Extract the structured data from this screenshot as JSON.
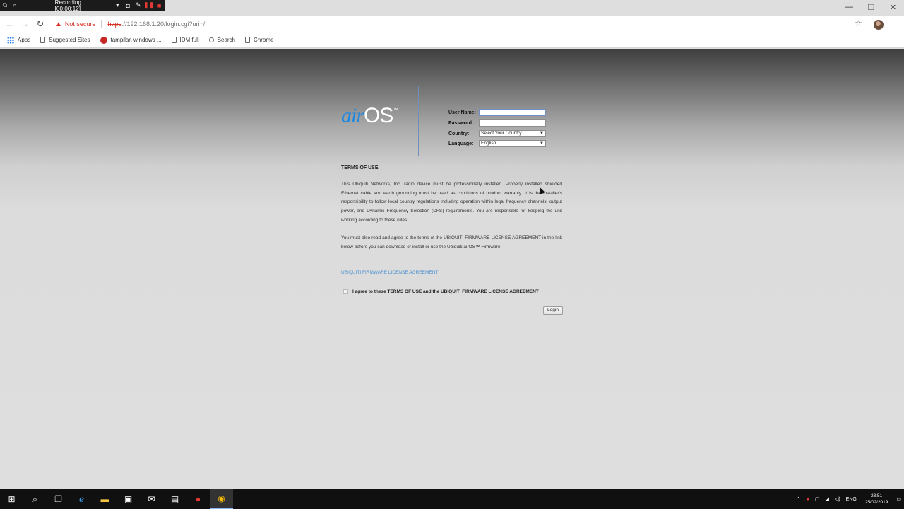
{
  "recorder": {
    "status": "Recording [00:00:12]"
  },
  "browser": {
    "not_secure": "Not secure",
    "url_protocol": "https",
    "url_rest": "://192.168.1.20/login.cgi?uri=/",
    "bookmarks": [
      {
        "label": "Apps",
        "icon": "apps-grid-icon"
      },
      {
        "label": "Suggested Sites",
        "icon": "page-icon"
      },
      {
        "label": "tampilan windows ...",
        "icon": "red-site-icon"
      },
      {
        "label": "IDM full",
        "icon": "page-icon"
      },
      {
        "label": "Search",
        "icon": "search-icon"
      },
      {
        "label": "Chrome",
        "icon": "page-icon"
      }
    ]
  },
  "logo": {
    "air": "air",
    "os": "OS",
    "tm": "™"
  },
  "login_form": {
    "username_label": "User Name:",
    "username_value": "",
    "password_label": "Password:",
    "password_value": "",
    "country_label": "Country:",
    "country_value": "Select Your Country",
    "language_label": "Language:",
    "language_value": "English"
  },
  "terms": {
    "title": "TERMS OF USE",
    "paragraph1": "This Ubiquiti Networks, Inc. radio device must be professionally installed. Properly installed shielded Ethernet cable and earth grounding must be used as conditions of product warranty. It is the installer's responsibility to follow local country regulations including operation within legal frequency channels, output power, and Dynamic Frequency Selection (DFS) requirements. You are responsible for keeping the unit working according to these rules.",
    "paragraph2": "You must also read and agree to the terms of the UBIQUITI FIRMWARE LICENSE AGREEMENT in the link below before you can download or install or use the Ubiquiti airOS™ Firmware.",
    "license_link": "UBIQUITI FIRMWARE LICENSE AGREEMENT",
    "agree_text": "I agree to these TERMS OF USE and the UBIQUITI FIRMWARE LICENSE AGREEMENT",
    "agree_checked": false,
    "login_button": "Login"
  },
  "taskbar": {
    "language": "ENG",
    "time": "23:51",
    "date": "25/02/2019"
  }
}
